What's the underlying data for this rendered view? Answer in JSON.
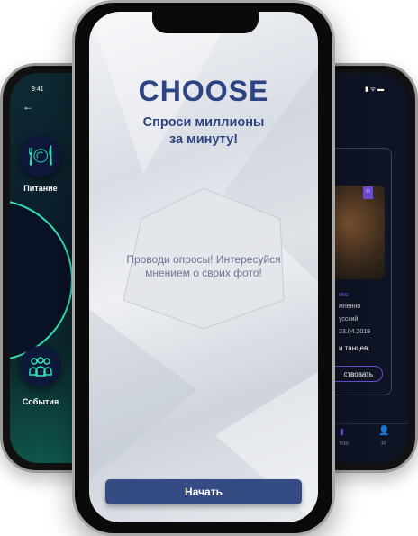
{
  "left_phone": {
    "time": "9:41",
    "categories": [
      {
        "label": "Питание",
        "icon": "plate-cutlery-icon"
      },
      {
        "label": "События",
        "icon": "people-icon"
      }
    ]
  },
  "center_phone": {
    "logo": "CHOOSE",
    "tagline_line1": "Спроси миллионы",
    "tagline_line2": "за минуту!",
    "intro_line1": "Проводи опросы! Интересуйся",
    "intro_line2": "мнением о своих фото!",
    "start_button": "Начать"
  },
  "right_phone": {
    "card_lines": [
      "икс",
      "мненно",
      "усский",
      "23.04.2019"
    ],
    "description": "и танцев.",
    "action_button": "ствовать",
    "nav": [
      {
        "label": "тия",
        "icon": "events-icon"
      },
      {
        "label": "Я",
        "icon": "person-icon"
      }
    ]
  },
  "colors": {
    "brand": "#2e4482",
    "button": "#344b84",
    "accent_teal": "#2ee6b8",
    "accent_purple": "#6b4bd6"
  }
}
